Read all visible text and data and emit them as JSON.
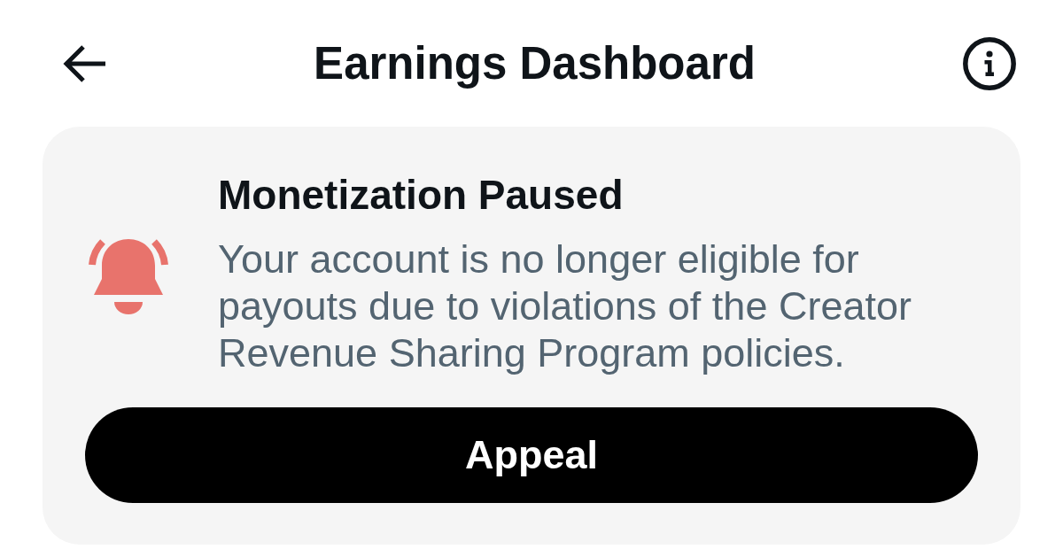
{
  "header": {
    "title": "Earnings Dashboard"
  },
  "notice": {
    "title": "Monetization Paused",
    "message": "Your account is no longer eligible for payouts due to violations of the Creator Revenue Sharing Program policies.",
    "button": "Appeal"
  }
}
